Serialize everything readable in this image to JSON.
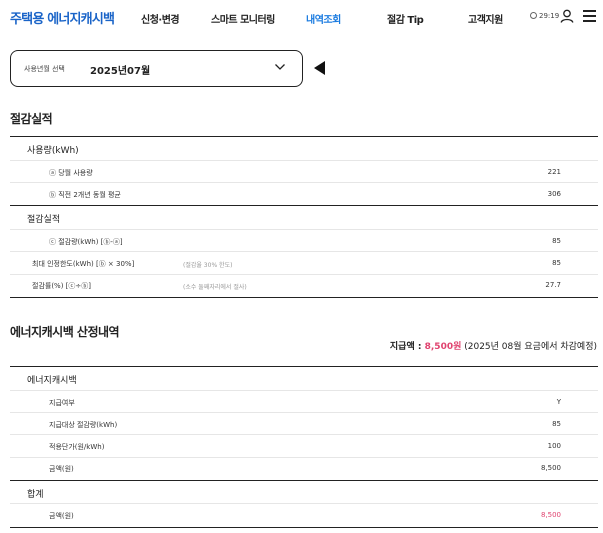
{
  "header": {
    "logo": "주택용 에너지캐시백",
    "nav": [
      "신청·변경",
      "스마트 모니터링",
      "내역조회",
      "절감 Tip",
      "고객지원"
    ],
    "active_index": 2,
    "timer": "29:19"
  },
  "selector": {
    "label": "사용년월 선택",
    "value": "2025년07월"
  },
  "savings": {
    "title": "절감실적",
    "usage_title": "사용량(kWh)",
    "usage_rows": [
      {
        "label": "ⓐ 당월 사용량",
        "value": "221"
      },
      {
        "label": "ⓑ 직전 2개년 동월 평균",
        "value": "306"
      }
    ],
    "result_title": "절감실적",
    "result_rows": [
      {
        "label": "ⓒ 절감량(kWh) [ⓑ-ⓐ]",
        "note": "",
        "value": "85"
      },
      {
        "label": "최대 인정한도(kWh) [ⓑ × 30%]",
        "note": "(절감율 30% 한도)",
        "value": "85"
      },
      {
        "label": "절감률(%) [ⓒ÷ⓑ]",
        "note": "(소수 둘째자리에서 절사)",
        "value": "27.7"
      }
    ]
  },
  "cashback": {
    "title": "에너지캐시백 산정내역",
    "pay_prefix": "지급액 : ",
    "pay_amount": "8,500원",
    "pay_suffix": " (2025년 08월 요금에서 차감예정)",
    "group_title": "에너지캐시백",
    "rows": [
      {
        "label": "지급여부",
        "value": "Y"
      },
      {
        "label": "지급대상 절감량(kWh)",
        "value": "85"
      },
      {
        "label": "적용단가(원/kWh)",
        "value": "100"
      },
      {
        "label": "금액(원)",
        "value": "8,500"
      }
    ],
    "total_title": "합계",
    "total_rows": [
      {
        "label": "금액(원)",
        "value": "8,500"
      }
    ]
  },
  "colors": {
    "brand_blue": "#1a64c8",
    "active_nav": "#1a7be0",
    "accent_pink": "#e0436f"
  }
}
